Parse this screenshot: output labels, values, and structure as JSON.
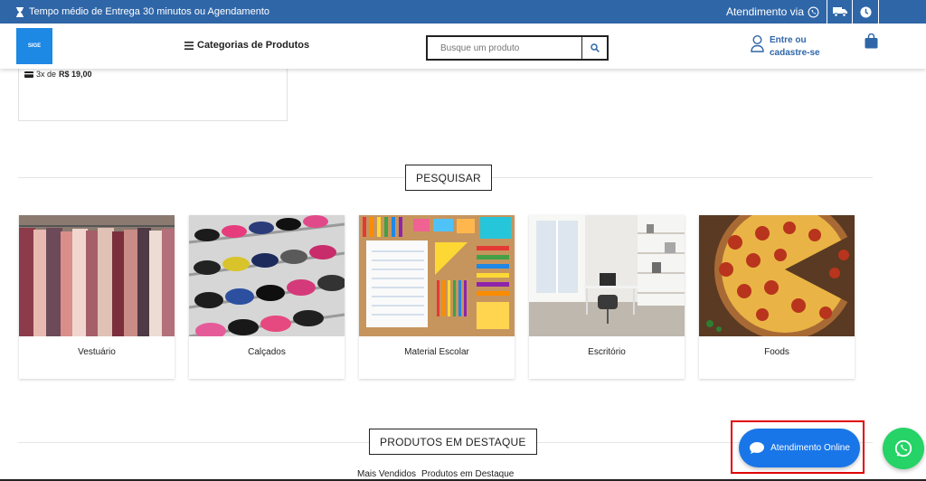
{
  "topbar": {
    "delivery_text": "Tempo médio de Entrega 30 minutos ou Agendamento",
    "attendance_text": "Atendimento via",
    "color": "#2f66a8"
  },
  "header": {
    "logo_text": "SIGE",
    "categories_label": "Categorias de Produtos",
    "search_placeholder": "Busque um produto",
    "login_line1": "Entre ou",
    "login_line2": "cadastre-se"
  },
  "product_card": {
    "installments_prefix": "3x de",
    "installments_value": "R$ 19,00"
  },
  "search_section": {
    "title": "PESQUISAR"
  },
  "categories": [
    {
      "label": "Vestuário"
    },
    {
      "label": "Calçados"
    },
    {
      "label": "Material Escolar"
    },
    {
      "label": "Escritório"
    },
    {
      "label": "Foods"
    }
  ],
  "featured_section": {
    "title": "PRODUTOS EM DESTAQUE",
    "tabs": [
      "Mais Vendidos",
      "Produtos em Destaque"
    ]
  },
  "chat": {
    "label": "Atendimento Online",
    "color": "#1976e8",
    "highlight_color": "#e00000"
  },
  "whatsapp": {
    "color": "#25d366",
    "icon": "whatsapp-icon"
  }
}
